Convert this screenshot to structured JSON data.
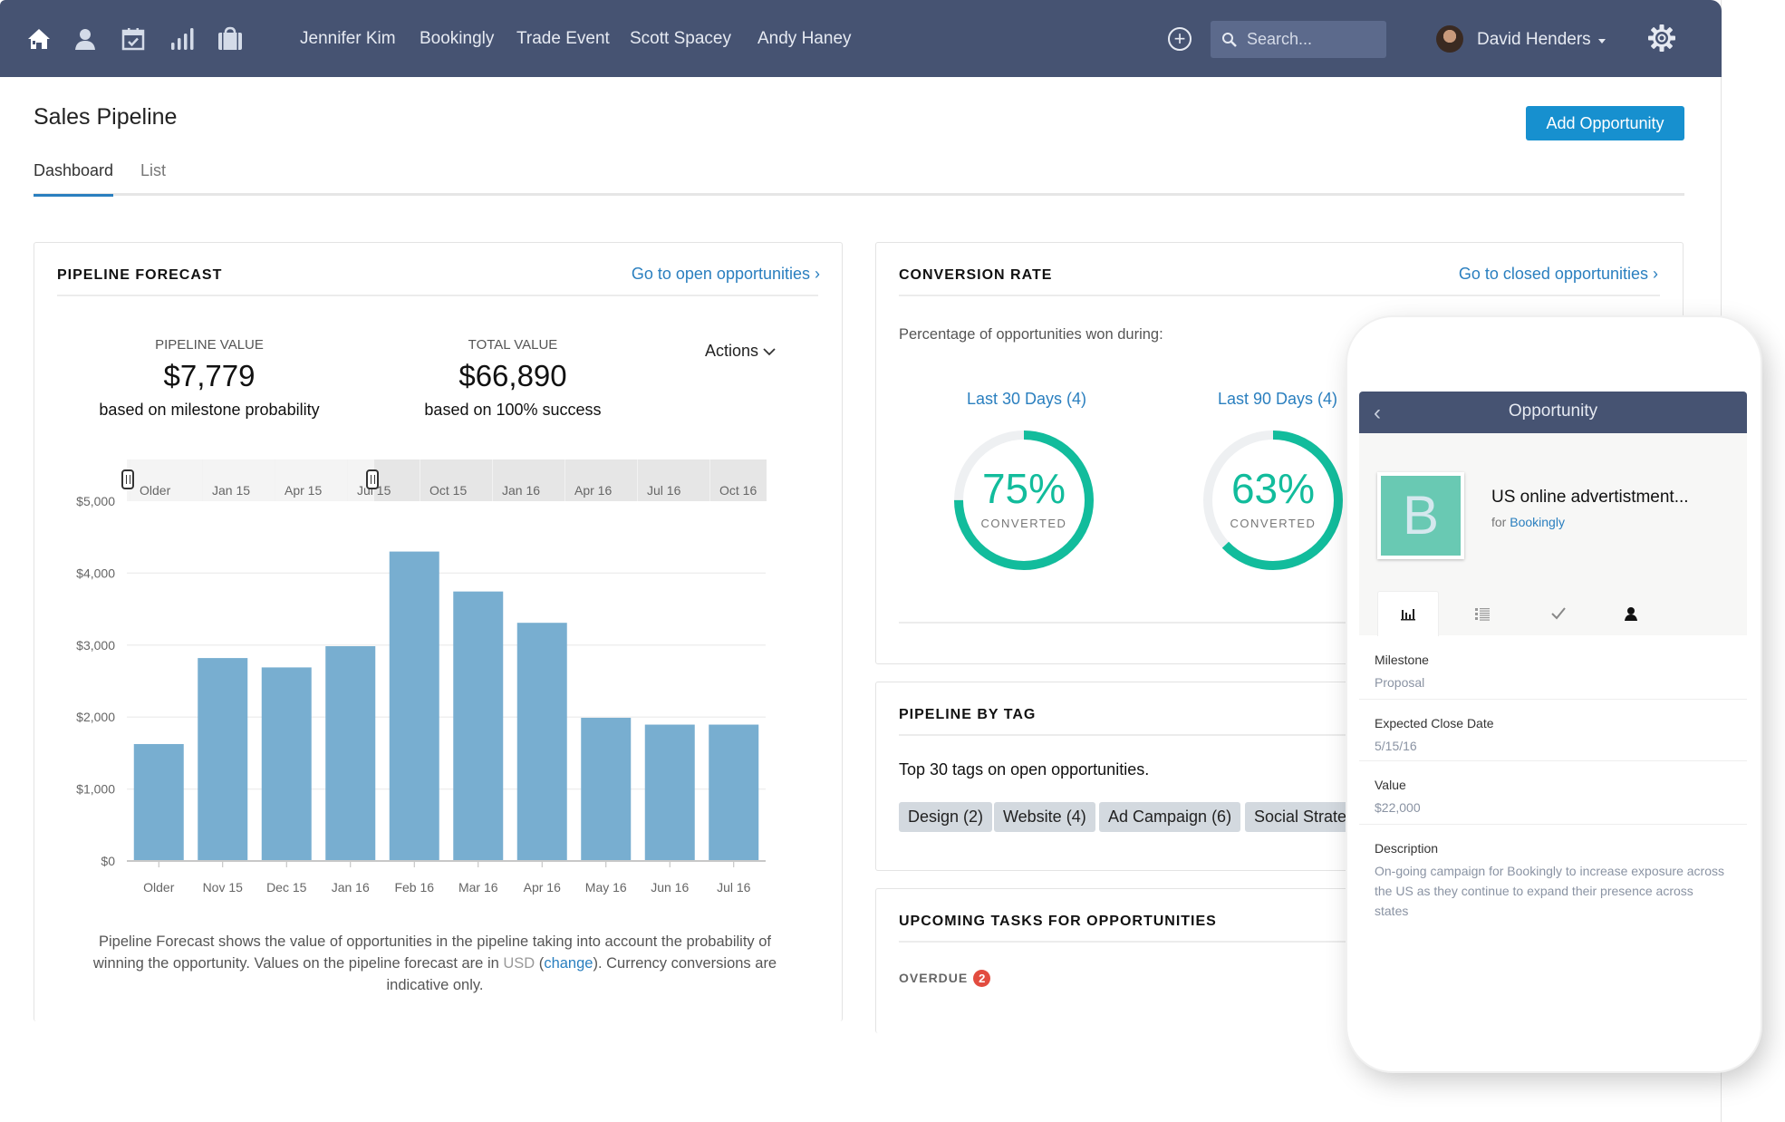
{
  "nav": {
    "icons": [
      "home-icon",
      "contact-icon",
      "calendar-icon",
      "reports-icon",
      "briefcase-icon"
    ],
    "recent": [
      "Jennifer Kim",
      "Bookingly",
      "Trade Event",
      "Scott Spacey",
      "Andy Haney"
    ],
    "search_placeholder": "Search...",
    "user_name": "David Henders"
  },
  "page": {
    "title": "Sales Pipeline",
    "add_button": "Add Opportunity",
    "tabs": [
      {
        "label": "Dashboard",
        "active": true
      },
      {
        "label": "List",
        "active": false
      }
    ]
  },
  "forecast": {
    "title": "PIPELINE FORECAST",
    "link": "Go to open opportunities ›",
    "pipeline_label": "PIPELINE VALUE",
    "pipeline_value": "$7,779",
    "pipeline_sub": "based on milestone probability",
    "total_label": "TOTAL VALUE",
    "total_value": "$66,890",
    "total_sub": "based on 100% success",
    "actions": "Actions",
    "range_labels": [
      "Older",
      "Jan 15",
      "Apr 15",
      "Jul 15",
      "Oct 15",
      "Jan 16",
      "Apr 16",
      "Jul 16",
      "Oct 16"
    ],
    "footnote_1": "Pipeline Forecast shows the value of opportunities in the pipeline taking into account the probability of winning the opportunity. Values on the pipeline forecast are in ",
    "footnote_usd": "USD",
    "footnote_open": " (",
    "footnote_change": "change",
    "footnote_2": "). Currency conversions are indicative only."
  },
  "chart_data": {
    "type": "bar",
    "title": "",
    "xlabel": "",
    "ylabel": "",
    "categories": [
      "Older",
      "Nov 15",
      "Dec 15",
      "Jan 16",
      "Feb 16",
      "Mar 16",
      "Apr 16",
      "May 16",
      "Jun 16",
      "Jul 16"
    ],
    "values": [
      1625,
      2820,
      2690,
      2985,
      4300,
      3745,
      3310,
      1990,
      1895,
      1895
    ],
    "ylim": [
      0,
      5000
    ],
    "yticks": [
      0,
      1000,
      2000,
      3000,
      4000,
      5000
    ],
    "ytick_labels": [
      "$0",
      "$1,000",
      "$2,000",
      "$3,000",
      "$4,000",
      "$5,000"
    ],
    "grid": true,
    "legend": "none",
    "color": "#78aed0"
  },
  "conversion": {
    "title": "CONVERSION RATE",
    "link": "Go to closed opportunities ›",
    "description": "Percentage of opportunities won during:",
    "periods": [
      {
        "label": "Last 30 Days (4)",
        "percent": 75,
        "percent_text": "75%",
        "caption": "CONVERTED"
      },
      {
        "label": "Last 90 Days (4)",
        "percent": 63,
        "percent_text": "63%",
        "caption": "CONVERTED"
      }
    ],
    "accent": "#12bc9c"
  },
  "tags": {
    "title": "PIPELINE BY TAG",
    "description": "Top 30 tags on open opportunities.",
    "items": [
      "Design (2)",
      "Website (4)",
      "Ad Campaign (6)",
      "Social Strategy"
    ]
  },
  "tasks": {
    "title": "UPCOMING TASKS FOR OPPORTUNITIES",
    "overdue_label": "OVERDUE",
    "overdue_count": "2"
  },
  "mobile": {
    "header": "Opportunity",
    "logo_letter": "B",
    "name": "US online advertistment...",
    "for_prefix": "for ",
    "for_company": "Bookingly",
    "tabs": [
      "chart-icon",
      "list-icon",
      "check-icon",
      "person-icon"
    ],
    "fields": [
      {
        "label": "Milestone",
        "value": "Proposal"
      },
      {
        "label": "Expected Close Date",
        "value": "5/15/16"
      },
      {
        "label": "Value",
        "value": "$22,000"
      },
      {
        "label": "Description",
        "value": "On-going campaign for Bookingly to increase exposure across the US as they continue to expand their presence across states"
      }
    ]
  }
}
